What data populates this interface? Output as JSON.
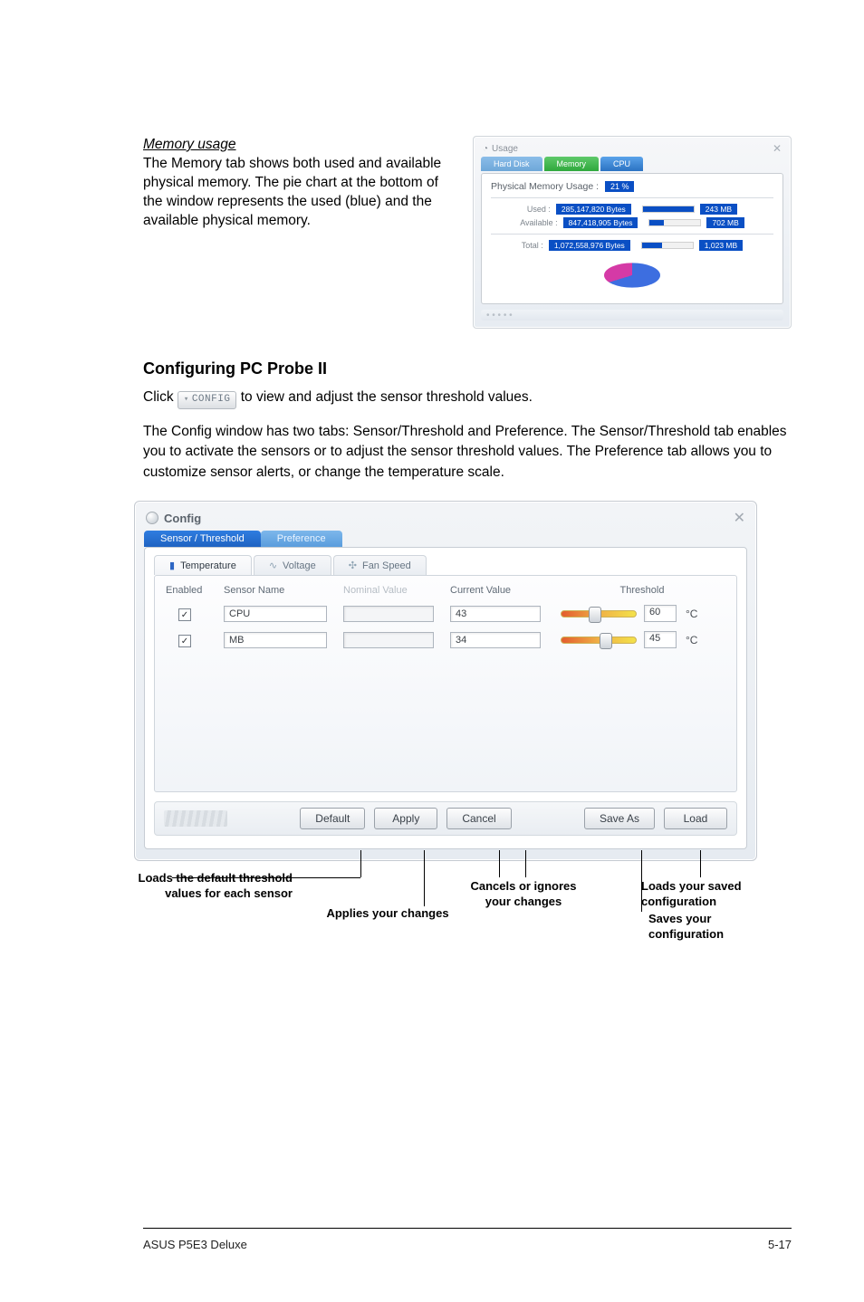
{
  "memory": {
    "heading": "Memory usage",
    "paragraph": "The Memory tab shows both used and available physical memory. The pie chart at the bottom of the window represents the used (blue) and the available physical memory.",
    "panel": {
      "title": "Usage",
      "close": "✕",
      "tabs": [
        "Hard Disk",
        "Memory",
        "CPU"
      ],
      "inner_title_prefix": "Physical Memory Usage :",
      "inner_title_pct": "21 %",
      "rows": [
        {
          "label": "Used :",
          "bytes": "285,147,820 Bytes",
          "mb": "243 MB",
          "fill": 100
        },
        {
          "label": "Available :",
          "bytes": "847,418,905 Bytes",
          "mb": "702 MB",
          "fill": 28
        }
      ],
      "total": {
        "label": "Total :",
        "bytes": "1,072,558,976 Bytes",
        "mb": "1,023 MB",
        "fill": 40
      }
    }
  },
  "configure": {
    "heading": "Configuring PC Probe II",
    "click_line": [
      "Click ",
      " to view and adjust the sensor threshold values."
    ],
    "config_btn": "CONFIG",
    "para2": "The Config window has two tabs: Sensor/Threshold and Preference. The Sensor/Threshold tab enables you to activate the sensors or to adjust the sensor threshold values. The Preference tab allows you to customize sensor alerts, or change the temperature scale."
  },
  "config_window": {
    "title": "Config",
    "close": "✕",
    "tabs": {
      "sensor": "Sensor / Threshold",
      "pref": "Preference"
    },
    "subtabs": {
      "temp": "Temperature",
      "volt": "Voltage",
      "fan": "Fan Speed"
    },
    "headers": {
      "enabled": "Enabled",
      "sensor": "Sensor Name",
      "nominal": "Nominal Value",
      "current": "Current Value",
      "threshold": "Threshold"
    },
    "rows": [
      {
        "name": "CPU",
        "current": "43",
        "threshold": "60",
        "unit": "°C",
        "knob": 36
      },
      {
        "name": "MB",
        "current": "34",
        "threshold": "45",
        "unit": "°C",
        "knob": 51
      }
    ],
    "buttons": {
      "default": "Default",
      "apply": "Apply",
      "cancel": "Cancel",
      "saveas": "Save As",
      "load": "Load"
    }
  },
  "annotations": {
    "loads_default": "Loads the default threshold values for each sensor",
    "applies": "Applies your changes",
    "cancels": "Cancels or ignores your changes",
    "loads_saved": "Loads your saved configuration",
    "saves": "Saves your configuration"
  },
  "footer": {
    "left": "ASUS P5E3 Deluxe",
    "right": "5-17"
  }
}
